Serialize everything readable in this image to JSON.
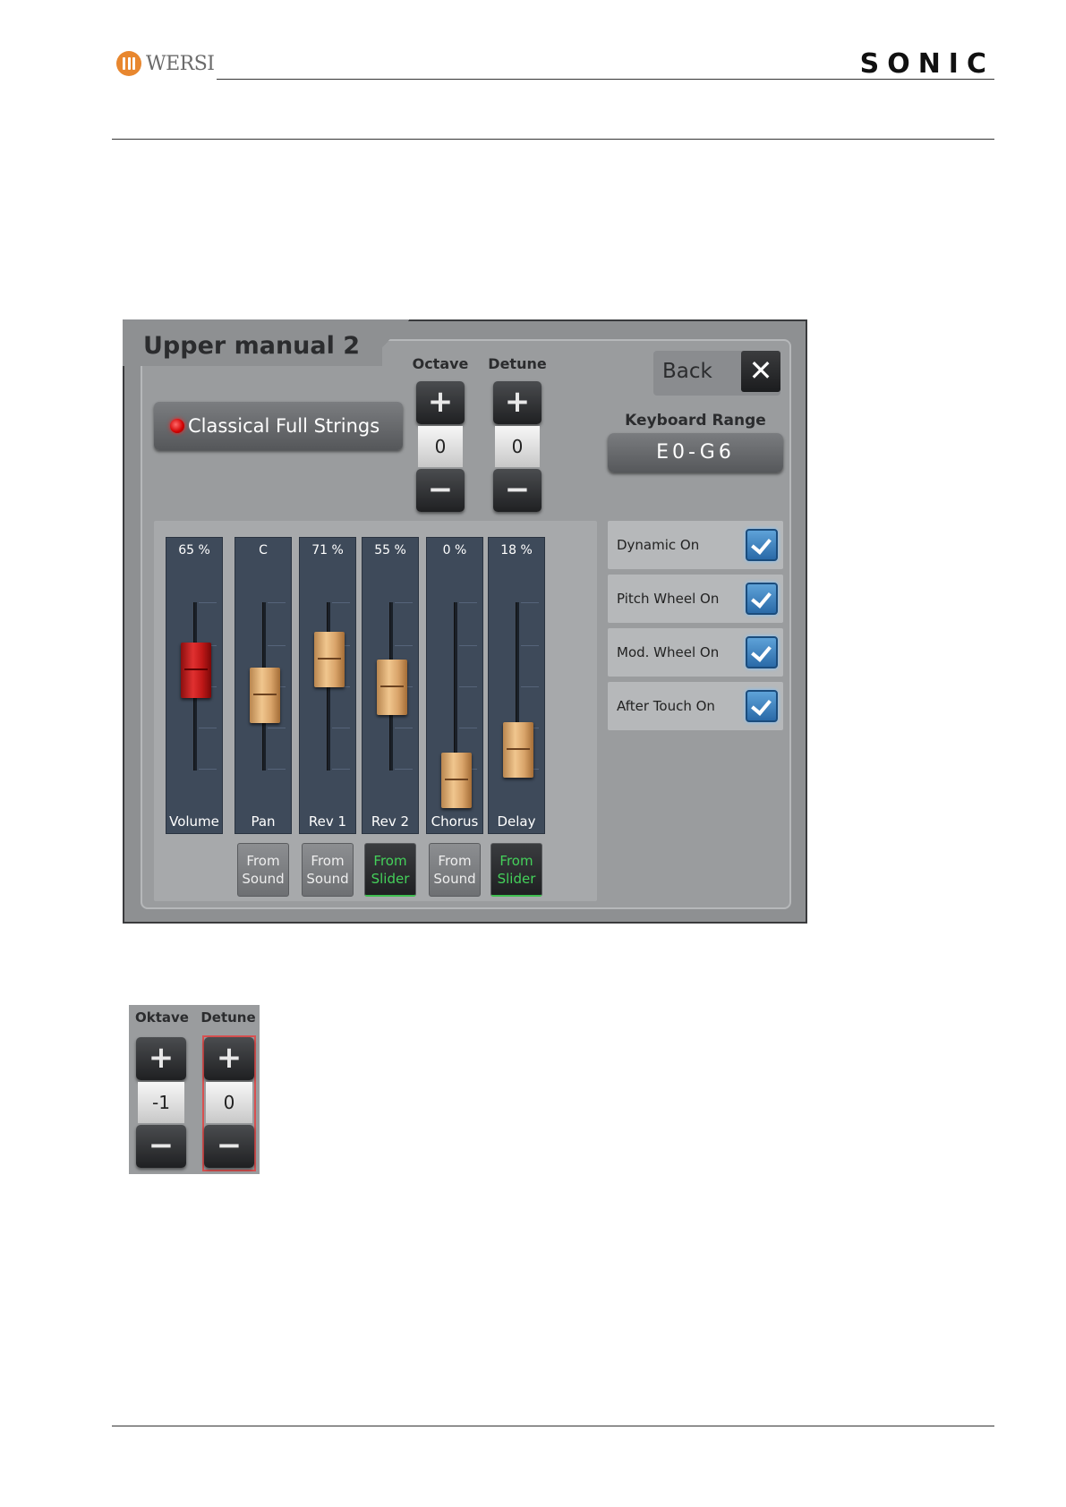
{
  "header": {
    "left_logo_text": "WERSI",
    "right_logo_text": "SONIC"
  },
  "panel": {
    "title": "Upper manual 2",
    "sound_name": "Classical Full Strings",
    "octave": {
      "label": "Octave",
      "plus": "+",
      "minus": "−",
      "value": "0"
    },
    "detune": {
      "label": "Detune",
      "plus": "+",
      "minus": "−",
      "value": "0"
    },
    "back_label": "Back",
    "close_symbol": "✕",
    "keyboard_range_label": "Keyboard Range",
    "keyboard_range_value": "E0-G6",
    "channels": [
      {
        "name": "Volume",
        "value": "65 %",
        "level": 0.65,
        "knob": "red"
      },
      {
        "name": "Pan",
        "value": "C",
        "level": 0.5,
        "knob": "wood",
        "source": "From\nSound",
        "source_active": false
      },
      {
        "name": "Rev 1",
        "value": "71 %",
        "level": 0.71,
        "knob": "wood",
        "source": "From\nSound",
        "source_active": false
      },
      {
        "name": "Rev 2",
        "value": "55 %",
        "level": 0.55,
        "knob": "wood",
        "source": "From\nSlider",
        "source_active": true
      },
      {
        "name": "Chorus",
        "value": "0 %",
        "level": 0.0,
        "knob": "wood",
        "source": "From\nSound",
        "source_active": false
      },
      {
        "name": "Delay",
        "value": "18 %",
        "level": 0.18,
        "knob": "wood",
        "source": "From\nSlider",
        "source_active": true
      }
    ],
    "options": [
      {
        "label": "Dynamic On",
        "checked": true
      },
      {
        "label": "Pitch Wheel On",
        "checked": true
      },
      {
        "label": "Mod. Wheel On",
        "checked": true
      },
      {
        "label": "After Touch On",
        "checked": true
      }
    ]
  },
  "small_panel": {
    "oktave": {
      "label": "Oktave",
      "plus": "+",
      "minus": "−",
      "value": "-1"
    },
    "detune": {
      "label": "Detune",
      "plus": "+",
      "minus": "−",
      "value": "0"
    }
  },
  "colors": {
    "led": "#ff2020",
    "active_source": "#44d05a",
    "checkbox": "#2a6aa8",
    "brand_orange": "#e8872f"
  }
}
